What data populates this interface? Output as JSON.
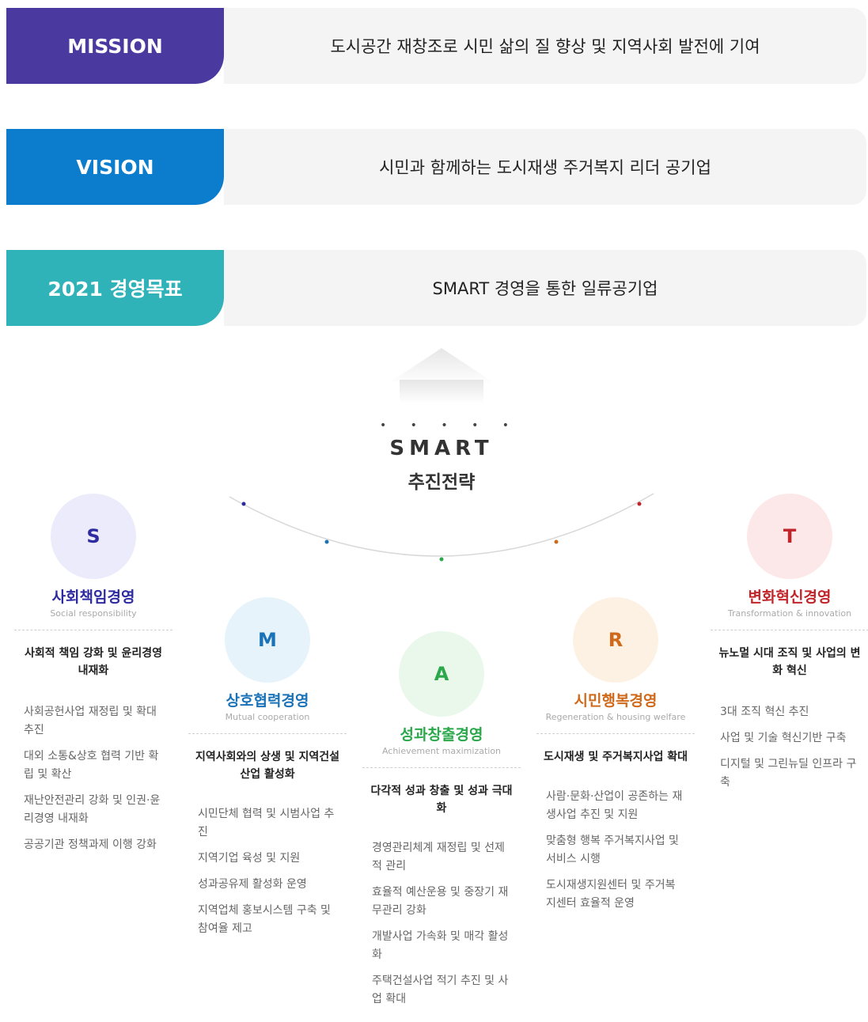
{
  "rows": {
    "mission": {
      "label": "MISSION",
      "text": "도시공간 재창조로 시민 삶의 질 향상 및 지역사회 발전에 기여"
    },
    "vision": {
      "label": "VISION",
      "text": "시민과 함께하는 도시재생 주거복지 리더 공기업"
    },
    "goal": {
      "label": "2021 경영목표",
      "text": "SMART 경영을 통한 일류공기업"
    }
  },
  "smart": {
    "dots": "• • • • •",
    "word": "SMART",
    "sub": "추진전략"
  },
  "colors": {
    "mission": "#4a3aa0",
    "vision": "#0b7dcc",
    "goal": "#2fb2b8"
  },
  "strategies": [
    {
      "letter": "S",
      "title": "사회책임경영",
      "en": "Social responsibility",
      "subtitle": "사회적 책임 강화 및 윤리경영 내재화",
      "color": "#2e2aa0",
      "bg": "#ecebfb",
      "items": [
        "사회공헌사업 재정립 및 확대 추진",
        "대외 소통&상호 협력 기반 확립 및 확산",
        "재난안전관리 강화 및 인권·윤리경영 내재화",
        "공공기관 정책과제 이행 강화"
      ]
    },
    {
      "letter": "M",
      "title": "상호협력경영",
      "en": "Mutual cooperation",
      "subtitle": "지역사회와의 상생 및 지역건설산업 활성화",
      "color": "#1a73b8",
      "bg": "#e6f3fb",
      "items": [
        "시민단체 협력 및 시범사업 추진",
        "지역기업 육성 및 지원",
        "성과공유제 활성화 운영",
        "지역업체 홍보시스템 구축 및 참여율 제고"
      ]
    },
    {
      "letter": "A",
      "title": "성과창출경영",
      "en": "Achievement maximization",
      "subtitle": "다각적 성과 창출 및 성과 극대화",
      "color": "#2aa84a",
      "bg": "#eaf8ec",
      "items": [
        "경영관리체계 재정립 및 선제적 관리",
        "효율적 예산운용 및 중장기 재무관리 강화",
        "개발사업 가속화 및 매각 활성화",
        "주택건설사업 적기 추진 및 사업 확대"
      ]
    },
    {
      "letter": "R",
      "title": "시민행복경영",
      "en": "Regeneration & housing welfare",
      "subtitle": "도시재생 및 주거복지사업 확대",
      "color": "#d06a1a",
      "bg": "#fdf1e4",
      "items": [
        "사람·문화·산업이 공존하는 재생사업 추진 및 지원",
        "맞춤형 행복 주거복지사업 및 서비스 시행",
        "도시재생지원센터 및 주거복지센터 효율적 운영"
      ]
    },
    {
      "letter": "T",
      "title": "변화혁신경영",
      "en": "Transformation & innovation",
      "subtitle": "뉴노멀 시대 조직 및 사업의 변화 혁신",
      "color": "#c0252a",
      "bg": "#fce8e8",
      "items": [
        "3대 조직 혁신 추진",
        "사업 및 기술 혁신기반 구축",
        "디지털 및 그린뉴딜 인프라 구축"
      ]
    }
  ]
}
